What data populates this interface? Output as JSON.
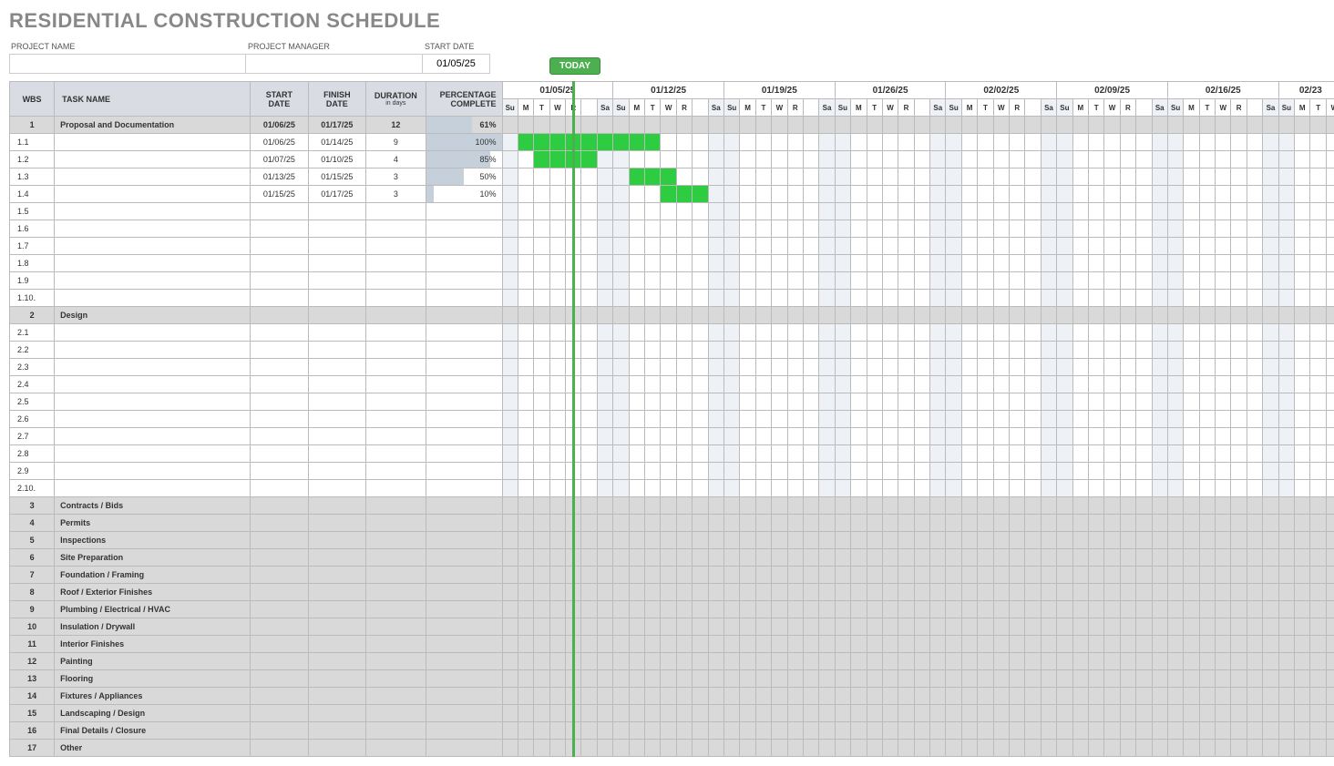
{
  "title": "RESIDENTIAL CONSTRUCTION SCHEDULE",
  "meta": {
    "project_name_label": "PROJECT NAME",
    "project_name": "",
    "project_manager_label": "PROJECT MANAGER",
    "project_manager": "",
    "start_date_label": "START DATE",
    "start_date": "01/05/25"
  },
  "today_label": "TODAY",
  "headers": {
    "wbs": "WBS",
    "task": "TASK NAME",
    "start": "START DATE",
    "finish": "FINISH DATE",
    "duration": "DURATION",
    "duration_sub": "in days",
    "percent": "PERCENTAGE COMPLETE"
  },
  "weeks": [
    "01/05/25",
    "01/12/25",
    "01/19/25",
    "01/26/25",
    "02/02/25",
    "02/09/25",
    "02/16/25",
    "02/23"
  ],
  "day_labels": [
    "Su",
    "M",
    "T",
    "W",
    "R",
    "",
    "Sa"
  ],
  "today_day_index": 5,
  "rows": [
    {
      "wbs": "1",
      "task": "Proposal and Documentation",
      "start": "01/06/25",
      "finish": "01/17/25",
      "dur": "12",
      "pct": "61%",
      "pct_val": 61,
      "phase": true,
      "bar_start": 1,
      "bar_end": 12
    },
    {
      "wbs": "1.1",
      "task": "",
      "start": "01/06/25",
      "finish": "01/14/25",
      "dur": "9",
      "pct": "100%",
      "pct_val": 100,
      "bar_start": 1,
      "bar_end": 9
    },
    {
      "wbs": "1.2",
      "task": "",
      "start": "01/07/25",
      "finish": "01/10/25",
      "dur": "4",
      "pct": "85%",
      "pct_val": 85,
      "bar_start": 2,
      "bar_end": 5
    },
    {
      "wbs": "1.3",
      "task": "",
      "start": "01/13/25",
      "finish": "01/15/25",
      "dur": "3",
      "pct": "50%",
      "pct_val": 50,
      "bar_start": 8,
      "bar_end": 10
    },
    {
      "wbs": "1.4",
      "task": "",
      "start": "01/15/25",
      "finish": "01/17/25",
      "dur": "3",
      "pct": "10%",
      "pct_val": 10,
      "bar_start": 10,
      "bar_end": 12
    },
    {
      "wbs": "1.5",
      "task": ""
    },
    {
      "wbs": "1.6",
      "task": ""
    },
    {
      "wbs": "1.7",
      "task": ""
    },
    {
      "wbs": "1.8",
      "task": ""
    },
    {
      "wbs": "1.9",
      "task": ""
    },
    {
      "wbs": "1.10.",
      "task": ""
    },
    {
      "wbs": "2",
      "task": "Design",
      "phase": true
    },
    {
      "wbs": "2.1",
      "task": ""
    },
    {
      "wbs": "2.2",
      "task": ""
    },
    {
      "wbs": "2.3",
      "task": ""
    },
    {
      "wbs": "2.4",
      "task": ""
    },
    {
      "wbs": "2.5",
      "task": ""
    },
    {
      "wbs": "2.6",
      "task": ""
    },
    {
      "wbs": "2.7",
      "task": ""
    },
    {
      "wbs": "2.8",
      "task": ""
    },
    {
      "wbs": "2.9",
      "task": ""
    },
    {
      "wbs": "2.10.",
      "task": ""
    },
    {
      "wbs": "3",
      "task": "Contracts / Bids",
      "phase": true
    },
    {
      "wbs": "4",
      "task": "Permits",
      "phase": true
    },
    {
      "wbs": "5",
      "task": "Inspections",
      "phase": true
    },
    {
      "wbs": "6",
      "task": "Site Preparation",
      "phase": true
    },
    {
      "wbs": "7",
      "task": "Foundation / Framing",
      "phase": true
    },
    {
      "wbs": "8",
      "task": "Roof / Exterior Finishes",
      "phase": true
    },
    {
      "wbs": "9",
      "task": "Plumbing / Electrical / HVAC",
      "phase": true
    },
    {
      "wbs": "10",
      "task": "Insulation / Drywall",
      "phase": true
    },
    {
      "wbs": "11",
      "task": "Interior Finishes",
      "phase": true
    },
    {
      "wbs": "12",
      "task": "Painting",
      "phase": true
    },
    {
      "wbs": "13",
      "task": "Flooring",
      "phase": true
    },
    {
      "wbs": "14",
      "task": "Fixtures / Appliances",
      "phase": true
    },
    {
      "wbs": "15",
      "task": "Landscaping / Design",
      "phase": true
    },
    {
      "wbs": "16",
      "task": "Final Details / Closure",
      "phase": true
    },
    {
      "wbs": "17",
      "task": "Other",
      "phase": true
    }
  ]
}
